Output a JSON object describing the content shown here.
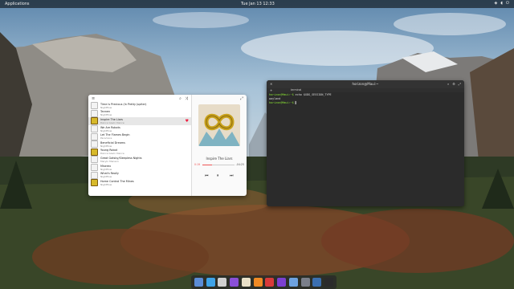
{
  "topbar": {
    "apps_label": "Applications",
    "clock": "Tue Jan 13 12:33"
  },
  "music": {
    "tracks": [
      {
        "title": "Time is Precious (In Pretty Jupiter)",
        "artist": "Nightflow"
      },
      {
        "title": "Tannen",
        "artist": "Nightflow"
      },
      {
        "title": "Inspire The Liars",
        "artist": "Dance Gavin Dance",
        "selected": true
      },
      {
        "title": "We Are Robots",
        "artist": "Nightflow"
      },
      {
        "title": "Let The Flames Begin",
        "artist": "Paramore"
      },
      {
        "title": "Beneficial Dreams",
        "artist": "Nightflow"
      },
      {
        "title": "Young Robot",
        "artist": "Dance Gavin Dance"
      },
      {
        "title": "Great Gatsby/Sleepless Nights",
        "artist": "Maryln Manson"
      },
      {
        "title": "Miserex",
        "artist": "Nightflow"
      },
      {
        "title": "What's Really",
        "artist": "Nightflow"
      },
      {
        "title": "Home Control The Mines",
        "artist": "Nightflow"
      }
    ],
    "now_playing": "Inspire The Liars",
    "position": "0:19",
    "duration": "-04:25",
    "progress": 0.3
  },
  "terminal": {
    "title": "horizon@Maui:~",
    "tab_label": "terminal",
    "lines": [
      {
        "prompt": "horizon@Maui:~$",
        "cmd": " echo $XDG_SESSION_TYPE"
      },
      {
        "output": "wayland"
      },
      {
        "prompt": "horizon@Maui:~$",
        "cmd": " ▌"
      }
    ]
  },
  "dock": {
    "apps": [
      {
        "name": "Window manager",
        "color": "#5b8cd6"
      },
      {
        "name": "Browser",
        "color": "#3ea3e8"
      },
      {
        "name": "Files",
        "color": "#d0d0d0"
      },
      {
        "name": "Tasks",
        "color": "#8a4fd8"
      },
      {
        "name": "Notes",
        "color": "#e9e0c8"
      },
      {
        "name": "Store",
        "color": "#f08a24"
      },
      {
        "name": "Music",
        "color": "#d83a3a"
      },
      {
        "name": "Video",
        "color": "#7b3fd0"
      },
      {
        "name": "Mail",
        "color": "#6da2e0"
      },
      {
        "name": "Settings",
        "color": "#7a7f8a"
      },
      {
        "name": "Desktop",
        "color": "#3b6fb0"
      },
      {
        "name": "Terminal",
        "color": "#2b2b2b"
      }
    ]
  },
  "colors": {
    "accent": "#e55353",
    "terminal_prompt": "#8ae234"
  }
}
